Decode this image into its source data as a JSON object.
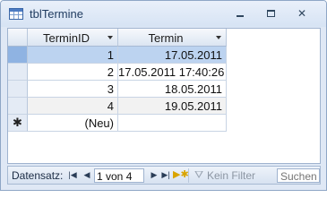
{
  "window": {
    "title": "tblTermine"
  },
  "table": {
    "columns": [
      "TerminID",
      "Termin"
    ],
    "rows": [
      {
        "id": "1",
        "termin": "17.05.2011"
      },
      {
        "id": "2",
        "termin": "17.05.2011 17:40:26"
      },
      {
        "id": "3",
        "termin": "18.05.2011"
      },
      {
        "id": "4",
        "termin": "19.05.2011"
      }
    ],
    "new_row_label": "(Neu)"
  },
  "navigation": {
    "label": "Datensatz:",
    "record_position": "1 von 4",
    "filter_label": "Kein Filter",
    "search_placeholder": "Suchen"
  },
  "icons": {
    "table": "table-icon",
    "minimize": "minimize-icon",
    "maximize": "maximize-icon",
    "close": "close-icon",
    "new_record": "asterisk-icon"
  }
}
